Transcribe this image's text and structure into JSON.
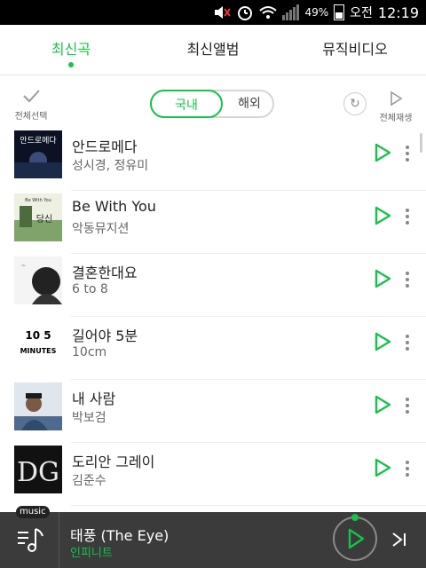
{
  "status_bar": {
    "battery": "49%",
    "ampm": "오전",
    "time": "12:19"
  },
  "tabs": [
    {
      "label": "최신곡",
      "active": true
    },
    {
      "label": "최신앨범",
      "active": false
    },
    {
      "label": "뮤직비디오",
      "active": false
    }
  ],
  "toolbar": {
    "select_all_label": "전체선택",
    "toggle": {
      "domestic": "국내",
      "foreign": "해외",
      "selected": "국내"
    },
    "play_all_label": "전체재생"
  },
  "songs": [
    {
      "title": "안드로메다",
      "artist": "성시경, 정유미"
    },
    {
      "title": "Be With You",
      "artist": "악동뮤지션"
    },
    {
      "title": "결혼한대요",
      "artist": "6 to 8"
    },
    {
      "title": "길어야 5분",
      "artist": "10cm"
    },
    {
      "title": "내 사람",
      "artist": "박보검"
    },
    {
      "title": "도리안 그레이",
      "artist": "김준수"
    }
  ],
  "album_art_text": {
    "row1": "안드로메다",
    "row2a": "Be With You",
    "row2b": "당신",
    "row4a": "10 5",
    "row4b": "MINUTES",
    "row6": "DG"
  },
  "player": {
    "badge": "music",
    "title": "태풍 (The Eye)",
    "artist": "인피니트"
  },
  "colors": {
    "accent": "#16c24a",
    "player_bg": "#3b3b3b"
  }
}
